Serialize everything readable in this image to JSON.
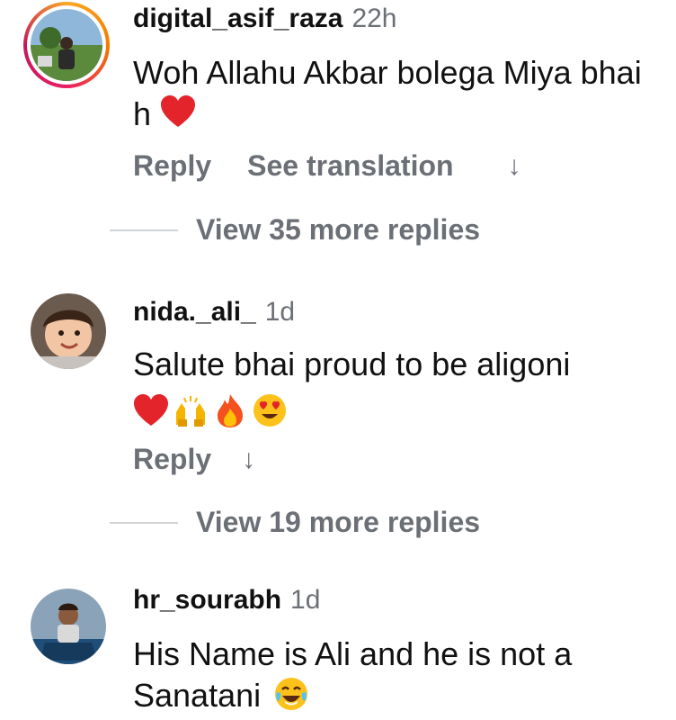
{
  "comments": [
    {
      "username": "digital_asif_raza",
      "time": "22h",
      "text": "Woh Allahu Akbar bolega Miya bhai h",
      "reply_label": "Reply",
      "translation_label": "See translation",
      "view_more": "View 35 more replies"
    },
    {
      "username": "nida._ali_",
      "time": "1d",
      "text": "Salute bhai proud to be aligoni",
      "reply_label": "Reply",
      "view_more": "View 19 more replies"
    },
    {
      "username": "hr_sourabh",
      "time": "1d",
      "text": "His Name is Ali and he is not a Sanatani"
    }
  ],
  "icons": {
    "arrow": "↓"
  },
  "colors": {
    "secondary_text": "#6b6f76",
    "heart": "#e3242b",
    "story_ring_start": "#f9a825",
    "story_ring_end": "#c2185b"
  }
}
